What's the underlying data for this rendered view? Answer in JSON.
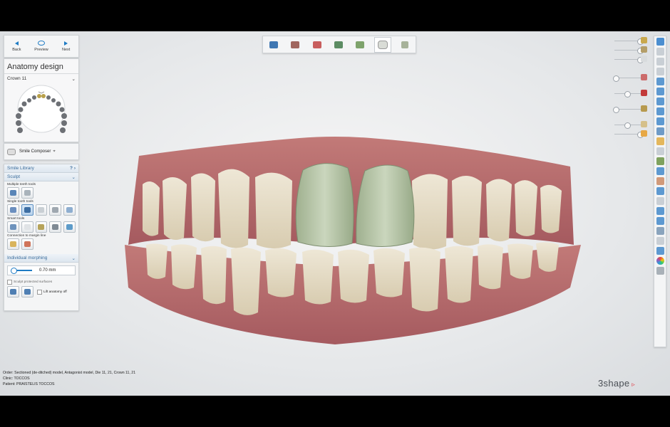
{
  "nav": {
    "back": "Back",
    "preview": "Preview",
    "next": "Next"
  },
  "anatomy": {
    "title": "Anatomy design",
    "crown": "Crown 11"
  },
  "smile_composer": "Smile Composer",
  "tools": {
    "smile_library": "Smile Library",
    "sculpt": "Sculpt",
    "multiple": "Multiple teeth tools",
    "single": "Single tooth tools",
    "smart": "Smart tools",
    "connection": "Connection to margin line",
    "morphing": "Individual morphing",
    "value": "0.70 mm",
    "protected": "Sculpt protected surfaces",
    "lift": "Lift anatomy off"
  },
  "info": {
    "order": "Order:   Sectioned (de-ditched) model, Antagonist model, Die 11, 21, Crown 11, 21",
    "clinic": "Clinic:    TOCCOS",
    "patient": "Patient:  PRAISTELIS TOCCOS"
  },
  "brand": "3shape",
  "colors": {
    "accent": "#1e7bc4",
    "crown": "#b9c8a8",
    "gum": "#b86a6e",
    "tooth": "#e9e2cf"
  }
}
